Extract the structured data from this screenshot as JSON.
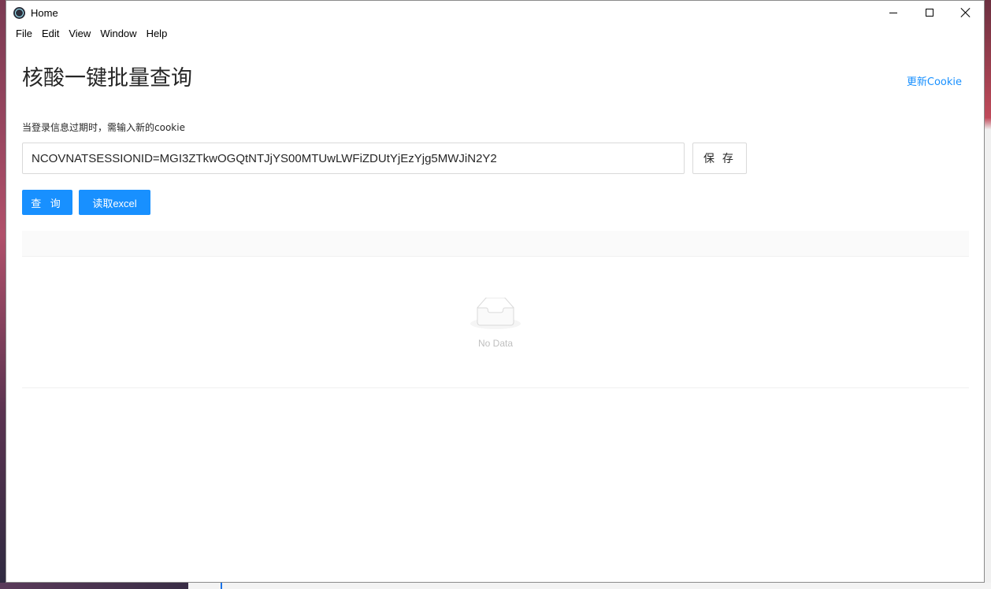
{
  "window": {
    "title": "Home",
    "app_icon": "electron-icon"
  },
  "menu": [
    "File",
    "Edit",
    "View",
    "Window",
    "Help"
  ],
  "page": {
    "title": "核酸一键批量查询",
    "update_cookie_link": "更新Cookie",
    "cookie_hint": "当登录信息过期时，需输入新的cookie",
    "cookie_value": "NCOVNATSESSIONID=MGI3ZTkwOGQtNTJjYS00MTUwLWFiZDUtYjEzYjg5MWJiN2Y2",
    "save_label": "保 存",
    "query_label": "查 询",
    "read_excel_label": "读取excel"
  },
  "table": {
    "empty_text": "No Data",
    "empty_icon": "inbox-icon"
  },
  "colors": {
    "primary": "#1890ff",
    "empty_text": "#bfbfbf"
  }
}
